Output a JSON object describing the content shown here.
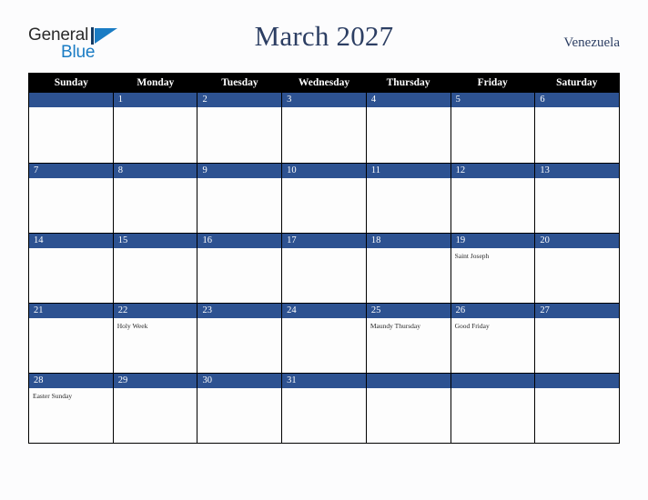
{
  "brand": {
    "name_part1": "General",
    "name_part2": "Blue",
    "mark": "triangle-logo-icon"
  },
  "header": {
    "title": "March 2027",
    "country": "Venezuela"
  },
  "colors": {
    "header_row_bg": "#000000",
    "day_bar_bg": "#2d5291",
    "title_text": "#2c3e63",
    "brand_blue": "#1a7cc4",
    "page_bg": "#fcfcfd",
    "cell_bg": "#fdfdfd",
    "grid_line": "#000000"
  },
  "calendar": {
    "weekdays": [
      "Sunday",
      "Monday",
      "Tuesday",
      "Wednesday",
      "Thursday",
      "Friday",
      "Saturday"
    ],
    "weeks": [
      [
        {
          "day": "",
          "events": []
        },
        {
          "day": "1",
          "events": []
        },
        {
          "day": "2",
          "events": []
        },
        {
          "day": "3",
          "events": []
        },
        {
          "day": "4",
          "events": []
        },
        {
          "day": "5",
          "events": []
        },
        {
          "day": "6",
          "events": []
        }
      ],
      [
        {
          "day": "7",
          "events": []
        },
        {
          "day": "8",
          "events": []
        },
        {
          "day": "9",
          "events": []
        },
        {
          "day": "10",
          "events": []
        },
        {
          "day": "11",
          "events": []
        },
        {
          "day": "12",
          "events": []
        },
        {
          "day": "13",
          "events": []
        }
      ],
      [
        {
          "day": "14",
          "events": []
        },
        {
          "day": "15",
          "events": []
        },
        {
          "day": "16",
          "events": []
        },
        {
          "day": "17",
          "events": []
        },
        {
          "day": "18",
          "events": []
        },
        {
          "day": "19",
          "events": [
            "Saint Joseph"
          ]
        },
        {
          "day": "20",
          "events": []
        }
      ],
      [
        {
          "day": "21",
          "events": []
        },
        {
          "day": "22",
          "events": [
            "Holy Week"
          ]
        },
        {
          "day": "23",
          "events": []
        },
        {
          "day": "24",
          "events": []
        },
        {
          "day": "25",
          "events": [
            "Maundy Thursday"
          ]
        },
        {
          "day": "26",
          "events": [
            "Good Friday"
          ]
        },
        {
          "day": "27",
          "events": []
        }
      ],
      [
        {
          "day": "28",
          "events": [
            "Easter Sunday"
          ]
        },
        {
          "day": "29",
          "events": []
        },
        {
          "day": "30",
          "events": []
        },
        {
          "day": "31",
          "events": []
        },
        {
          "day": "",
          "events": []
        },
        {
          "day": "",
          "events": []
        },
        {
          "day": "",
          "events": []
        }
      ]
    ]
  }
}
